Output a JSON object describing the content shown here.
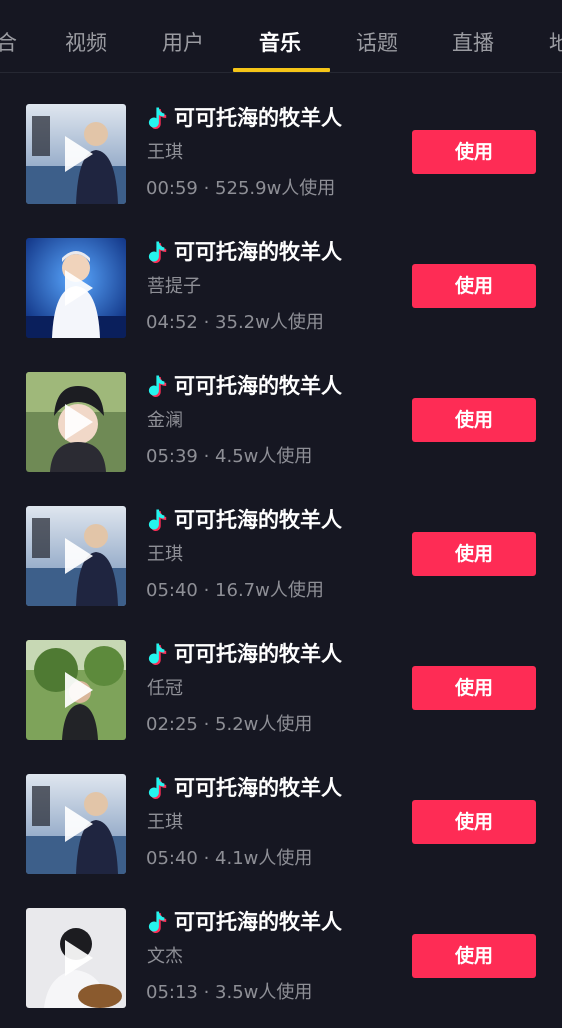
{
  "tabs": [
    {
      "label": "合"
    },
    {
      "label": "视频"
    },
    {
      "label": "用户"
    },
    {
      "label": "音乐"
    },
    {
      "label": "话题"
    },
    {
      "label": "直播"
    },
    {
      "label": "地"
    }
  ],
  "active_tab": "音乐",
  "colors": {
    "background": "#161722",
    "accent_underline": "#f5c518",
    "use_button": "#fe2c55",
    "note_cyan": "#25f4ee",
    "note_red": "#fe2c55"
  },
  "songs": [
    {
      "title": "可可托海的牧羊人",
      "artist": "王琪",
      "meta": "00:59 · 525.9w人使用",
      "button": "使用",
      "cover_icon": "play-icon"
    },
    {
      "title": "可可托海的牧羊人",
      "artist": "菩提子",
      "meta": "04:52 · 35.2w人使用",
      "button": "使用",
      "cover_icon": "play-icon"
    },
    {
      "title": "可可托海的牧羊人",
      "artist": "金澜",
      "meta": "05:39 · 4.5w人使用",
      "button": "使用",
      "cover_icon": "play-icon"
    },
    {
      "title": "可可托海的牧羊人",
      "artist": "王琪",
      "meta": "05:40 · 16.7w人使用",
      "button": "使用",
      "cover_icon": "play-icon"
    },
    {
      "title": "可可托海的牧羊人",
      "artist": "任冠",
      "meta": "02:25 · 5.2w人使用",
      "button": "使用",
      "cover_icon": "play-icon"
    },
    {
      "title": "可可托海的牧羊人",
      "artist": "王琪",
      "meta": "05:40 · 4.1w人使用",
      "button": "使用",
      "cover_icon": "play-icon"
    },
    {
      "title": "可可托海的牧羊人",
      "artist": "文杰",
      "meta": "05:13 · 3.5w人使用",
      "button": "使用",
      "cover_icon": "play-icon"
    }
  ]
}
